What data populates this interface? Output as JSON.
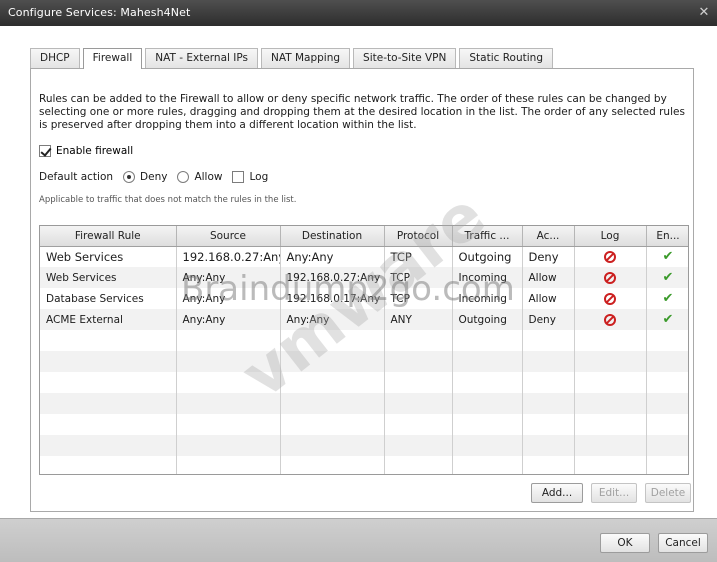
{
  "window": {
    "title": "Configure Services: Mahesh4Net",
    "close_glyph": "✕"
  },
  "tabs": [
    {
      "label": "DHCP",
      "active": false
    },
    {
      "label": "Firewall",
      "active": true
    },
    {
      "label": "NAT - External IPs",
      "active": false
    },
    {
      "label": "NAT Mapping",
      "active": false
    },
    {
      "label": "Site-to-Site VPN",
      "active": false
    },
    {
      "label": "Static Routing",
      "active": false
    }
  ],
  "firewall": {
    "description": "Rules can be added to the Firewall to allow or deny specific network traffic. The order of these rules can be changed by selecting one or more rules, dragging and dropping them at the desired location in the list. The order of any selected rules is preserved after dropping them into a different location within the list.",
    "enable_label": "Enable firewall",
    "enable_checked": true,
    "default_action_label": "Default action",
    "options": {
      "deny": "Deny",
      "allow": "Allow",
      "log": "Log"
    },
    "selected_action": "deny",
    "log_checked": false,
    "hint": "Applicable to traffic that does not match the rules in the list."
  },
  "table": {
    "columns": [
      "Firewall Rule",
      "Source",
      "Destination",
      "Protocol",
      "Traffic ...",
      "Ac...",
      "Log",
      "En..."
    ],
    "rows": [
      {
        "rule": "Web Services",
        "source": "192.168.0.27:Any",
        "destination": "Any:Any",
        "protocol": "TCP",
        "traffic": "Outgoing",
        "action": "Deny",
        "log_icon": "blocked-icon",
        "enabled_icon": "check-icon"
      },
      {
        "rule": "Web Services",
        "source": "Any:Any",
        "destination": "192.168.0.27:Any",
        "protocol": "TCP",
        "traffic": "Incoming",
        "action": "Allow",
        "log_icon": "blocked-icon",
        "enabled_icon": "check-icon"
      },
      {
        "rule": "Database Services",
        "source": "Any:Any",
        "destination": "192.168.0.17:Any",
        "protocol": "TCP",
        "traffic": "Incoming",
        "action": "Allow",
        "log_icon": "blocked-icon",
        "enabled_icon": "check-icon"
      },
      {
        "rule": "ACME External",
        "source": "Any:Any",
        "destination": "Any:Any",
        "protocol": "ANY",
        "traffic": "Outgoing",
        "action": "Deny",
        "log_icon": "blocked-icon",
        "enabled_icon": "check-icon"
      }
    ],
    "check_glyph": "✔"
  },
  "buttons": {
    "add": "Add...",
    "edit": "Edit...",
    "delete": "Delete",
    "ok": "OK",
    "cancel": "Cancel"
  },
  "watermark": {
    "text": "Braindump2go.com",
    "brand": "vmware"
  },
  "colors": {
    "titlebar": "#3a3a3a",
    "deny_icon": "#cc2020",
    "enabled_check": "#3a9a2a"
  }
}
